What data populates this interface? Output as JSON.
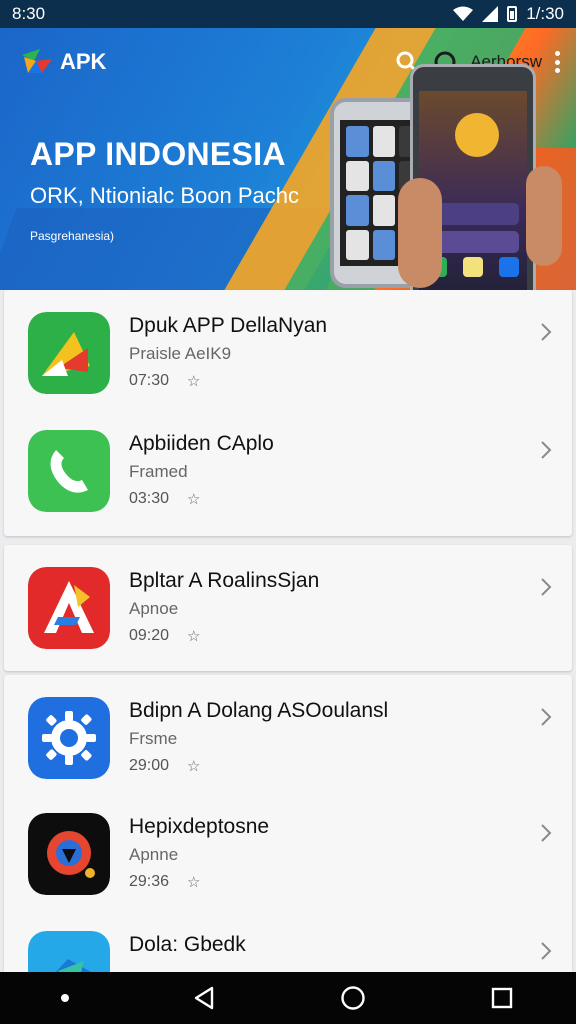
{
  "status_bar": {
    "time_left": "8:30",
    "time_right": "1/:30"
  },
  "header": {
    "brand": "APK",
    "account_label": "Aerhorsw",
    "title": "APP INDONESIA",
    "subtitle": "ORK, Ntionialc Boon Pachc",
    "caption": "Pasgrehanesia)"
  },
  "apps": [
    {
      "name": "Dpuk APP DellaNyan",
      "sub": "Praisle AeIK9",
      "time": "07:30",
      "mark": "☆"
    },
    {
      "name": "Apbiiden CAplo",
      "sub": "Framed",
      "time": "03:30",
      "mark": "☆"
    },
    {
      "name": "Bpltar A RoalinsSjan",
      "sub": "Apnoe",
      "time": "09:20",
      "mark": "☆"
    },
    {
      "name": "Bdipn A Dolang ASOoulansl",
      "sub": "Frsme",
      "time": "29:00",
      "mark": "☆"
    },
    {
      "name": "Hepixdeptosne",
      "sub": "Apnne",
      "time": "29:36",
      "mark": "☆"
    },
    {
      "name": "Dola: Gbedk",
      "sub": "",
      "time": "",
      "mark": ""
    }
  ],
  "colors": {
    "status_bar_bg": "#0c2f4e",
    "accent_blue": "#1b66c9",
    "accent_orange": "#f3a21a",
    "accent_green": "#21a86a"
  },
  "icons": {
    "status": [
      "wifi-icon",
      "signal-icon",
      "battery-icon"
    ],
    "appbar": [
      "search-icon",
      "account-circle-icon",
      "more-vert-icon"
    ],
    "nav": [
      "back-icon",
      "home-icon",
      "recents-icon"
    ]
  }
}
